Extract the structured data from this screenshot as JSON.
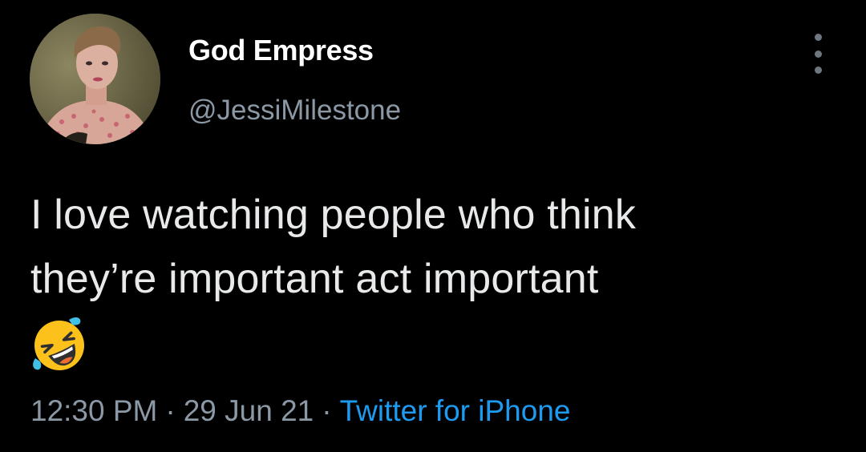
{
  "author": {
    "display_name": "God Empress",
    "handle": "@JessiMilestone",
    "avatar": "avatar-portrait-image"
  },
  "more_menu_icon": "more-vertical-icon",
  "tweet": {
    "lines": [
      "I love watching people who think",
      "they’re important act important"
    ],
    "emoji": "rolling-on-the-floor-laughing-emoji"
  },
  "meta": {
    "time": "12:30 PM",
    "separator": "·",
    "date": "29 Jun 21",
    "source": "Twitter for iPhone"
  },
  "colors": {
    "background": "#000000",
    "text": "#e7e9ea",
    "secondary": "#8b98a5",
    "link": "#1d9bf0"
  }
}
